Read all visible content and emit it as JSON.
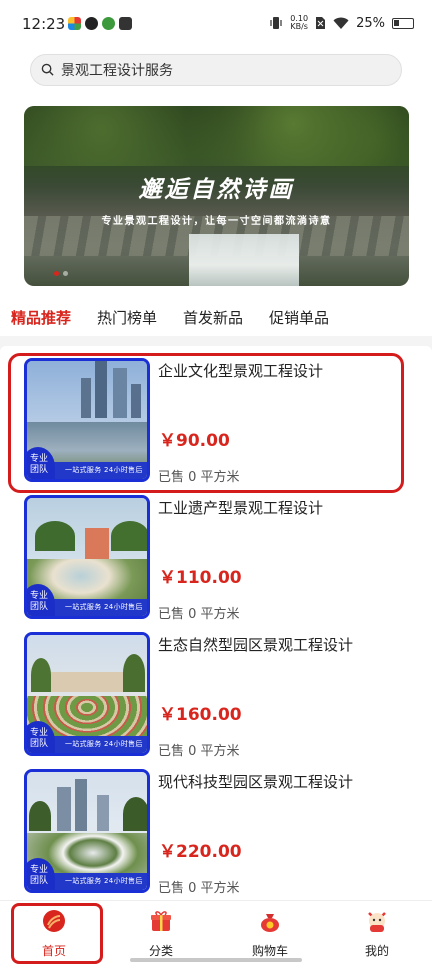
{
  "status_bar": {
    "time": "12:23",
    "net_speed_value": "0.10",
    "net_speed_unit": "KB/s",
    "battery": "25%"
  },
  "search": {
    "text": "景观工程设计服务"
  },
  "banner": {
    "title": "邂逅自然诗画",
    "subtitle": "专业景观工程设计，让每一寸空间都流淌诗意"
  },
  "tabs": [
    {
      "label": "精品推荐",
      "active": true
    },
    {
      "label": "热门榜单",
      "active": false
    },
    {
      "label": "首发新品",
      "active": false
    },
    {
      "label": "促销单品",
      "active": false
    }
  ],
  "products": [
    {
      "name": "企业文化型景观工程设计",
      "price": "￥90.00",
      "sold": "已售 0 平方米",
      "badge": "专业团队",
      "ribbon": "一站式服务 24小时售后"
    },
    {
      "name": "工业遗产型景观工程设计",
      "price": "￥110.00",
      "sold": "已售 0 平方米",
      "badge": "专业团队",
      "ribbon": "一站式服务 24小时售后"
    },
    {
      "name": "生态自然型园区景观工程设计",
      "price": "￥160.00",
      "sold": "已售 0 平方米",
      "badge": "专业团队",
      "ribbon": "一站式服务 24小时售后"
    },
    {
      "name": "现代科技型园区景观工程设计",
      "price": "￥220.00",
      "sold": "已售 0 平方米",
      "badge": "专业团队",
      "ribbon": "一站式服务 24小时售后"
    }
  ],
  "bottom_nav": [
    {
      "label": "首页",
      "icon": "home-icon",
      "active": true
    },
    {
      "label": "分类",
      "icon": "gift-box-icon",
      "active": false
    },
    {
      "label": "购物车",
      "icon": "money-bag-icon",
      "active": false
    },
    {
      "label": "我的",
      "icon": "fortune-cat-icon",
      "active": false
    }
  ],
  "colors": {
    "accent": "#d8261e",
    "badge_blue": "#1c2ec8"
  }
}
